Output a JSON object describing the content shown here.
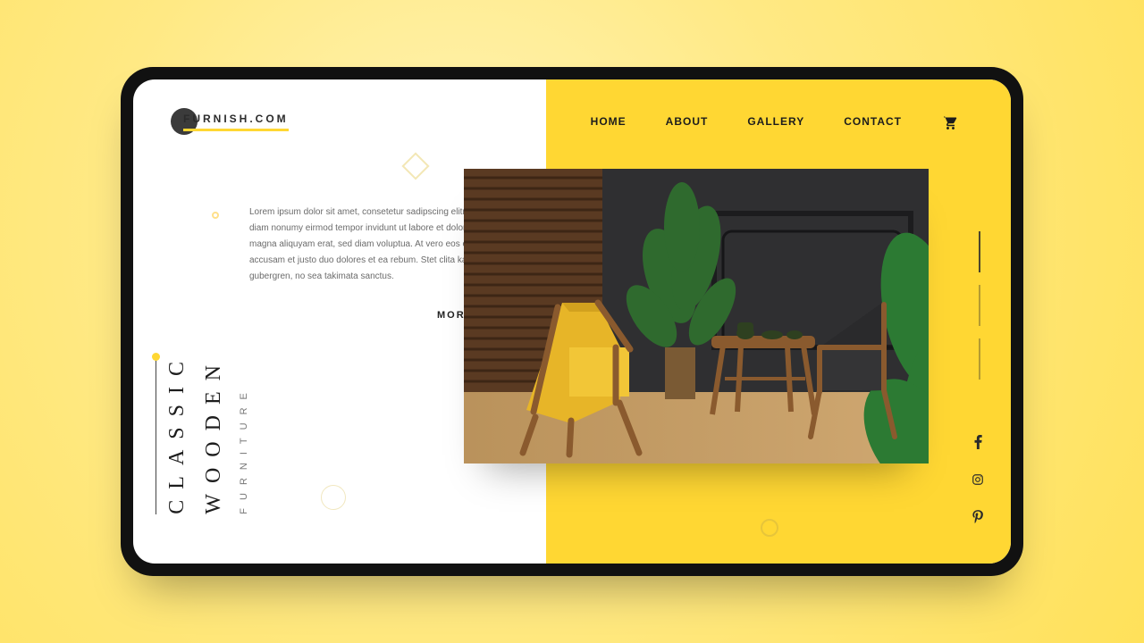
{
  "brand": {
    "name": "FURNISH.COM"
  },
  "nav": {
    "items": [
      "HOME",
      "ABOUT",
      "GALLERY",
      "CONTACT"
    ]
  },
  "hero": {
    "body": "Lorem ipsum dolor sit amet, consetetur sadipscing elitr, sed diam nonumy eirmod tempor invidunt ut labore et dolore magna aliquyam erat, sed diam voluptua. At vero eos et accusam et justo duo dolores et ea rebum. Stet clita kasd gubergren, no sea takimata sanctus.",
    "more_label": "MORE",
    "heading_line1": "CLASSIC",
    "heading_line2": "WOODEN",
    "heading_sub": "FURNITURE"
  },
  "colors": {
    "accent": "#ffd733",
    "ink": "#1c1c1c"
  }
}
